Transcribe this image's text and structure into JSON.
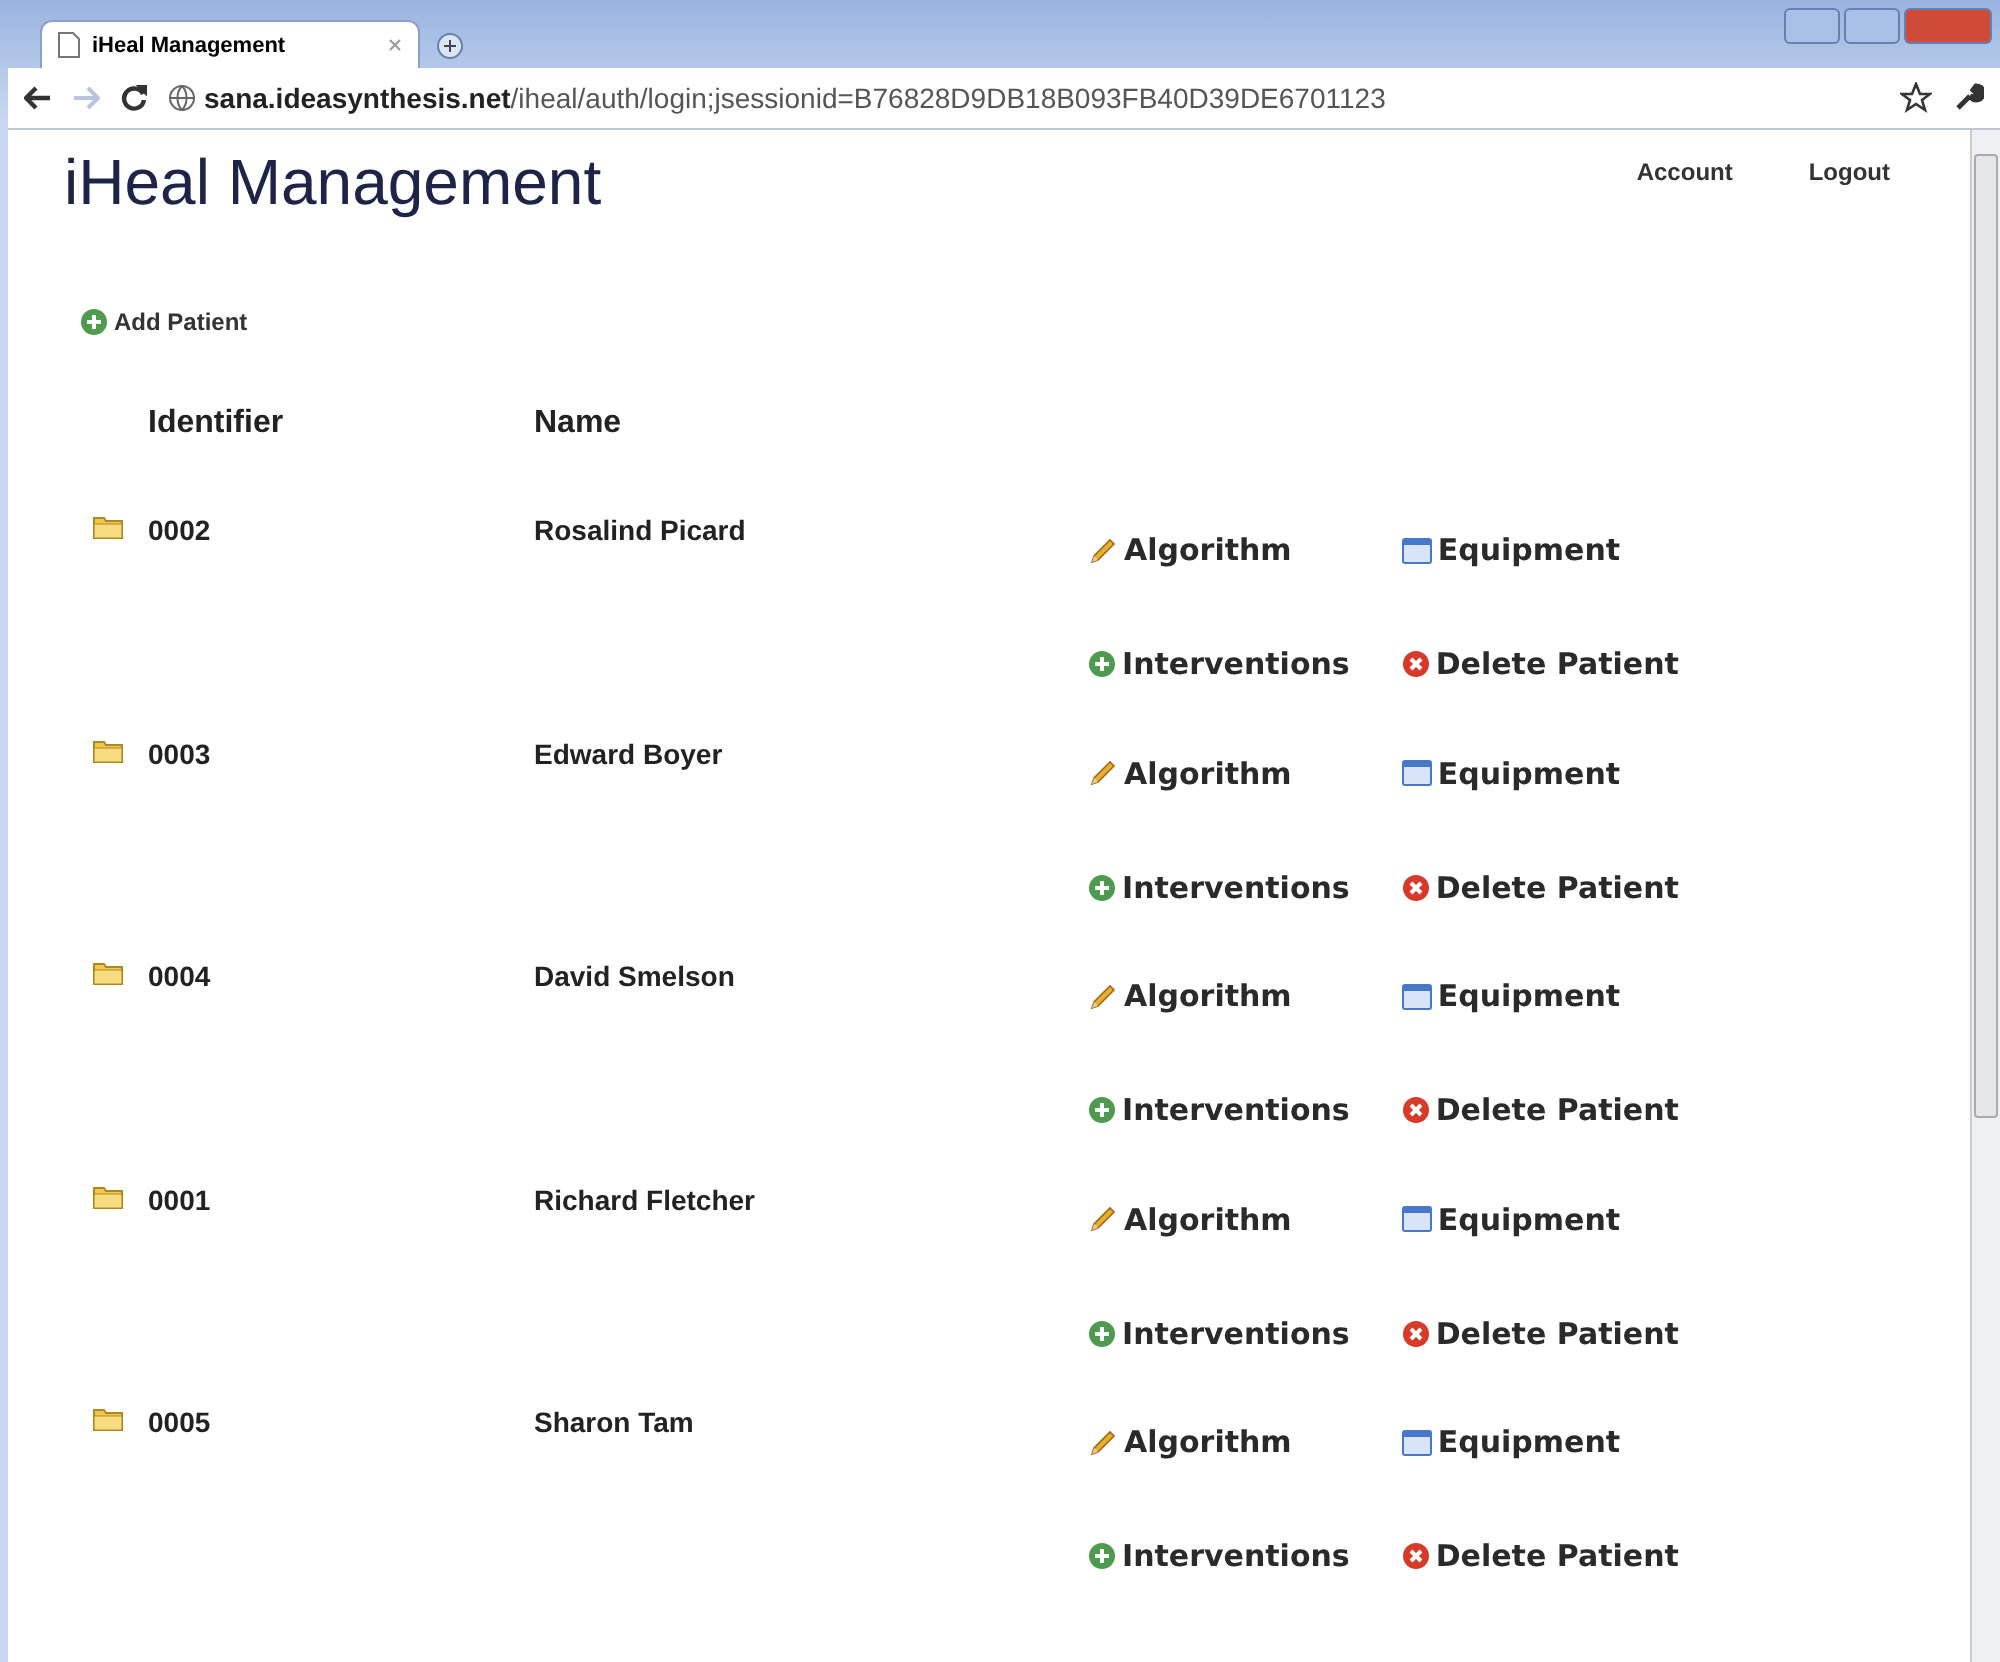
{
  "window": {
    "tab_title": "iHeal Management",
    "url_host": "sana.ideasynthesis.net",
    "url_path": "/iheal/auth/login;jsessionid=B76828D9DB18B093FB40D39DE6701123"
  },
  "header": {
    "title": "iHeal Management",
    "nav": [
      "Account",
      "Logout"
    ]
  },
  "add_button": {
    "label": "Add Patient"
  },
  "table": {
    "columns": [
      "Identifier",
      "Name"
    ],
    "rows": [
      {
        "identifier": "0002",
        "name": "Rosalind Picard",
        "actions": [
          {
            "kind": "edit",
            "label": "Algorithm"
          },
          {
            "kind": "equipment",
            "label": "Equipment"
          },
          {
            "kind": "add",
            "label": "Interventions"
          },
          {
            "kind": "delete",
            "label": "Delete Patient"
          }
        ]
      },
      {
        "identifier": "0003",
        "name": "Edward Boyer",
        "actions": [
          {
            "kind": "edit",
            "label": "Algorithm"
          },
          {
            "kind": "equipment",
            "label": "Equipment"
          },
          {
            "kind": "add",
            "label": "Interventions"
          },
          {
            "kind": "delete",
            "label": "Delete Patient"
          }
        ]
      },
      {
        "identifier": "0004",
        "name": "David Smelson",
        "actions": [
          {
            "kind": "edit",
            "label": "Algorithm"
          },
          {
            "kind": "equipment",
            "label": "Equipment"
          },
          {
            "kind": "add",
            "label": "Interventions"
          },
          {
            "kind": "delete",
            "label": "Delete Patient"
          }
        ]
      },
      {
        "identifier": "0001",
        "name": "Richard Fletcher",
        "actions": [
          {
            "kind": "edit",
            "label": "Algorithm"
          },
          {
            "kind": "equipment",
            "label": "Equipment"
          },
          {
            "kind": "add",
            "label": "Interventions"
          },
          {
            "kind": "delete",
            "label": "Delete Patient"
          }
        ]
      },
      {
        "identifier": "0005",
        "name": "Sharon Tam",
        "actions": [
          {
            "kind": "edit",
            "label": "Algorithm"
          },
          {
            "kind": "equipment",
            "label": "Equipment"
          },
          {
            "kind": "add",
            "label": "Interventions"
          },
          {
            "kind": "delete",
            "label": "Delete Patient"
          }
        ]
      }
    ]
  }
}
